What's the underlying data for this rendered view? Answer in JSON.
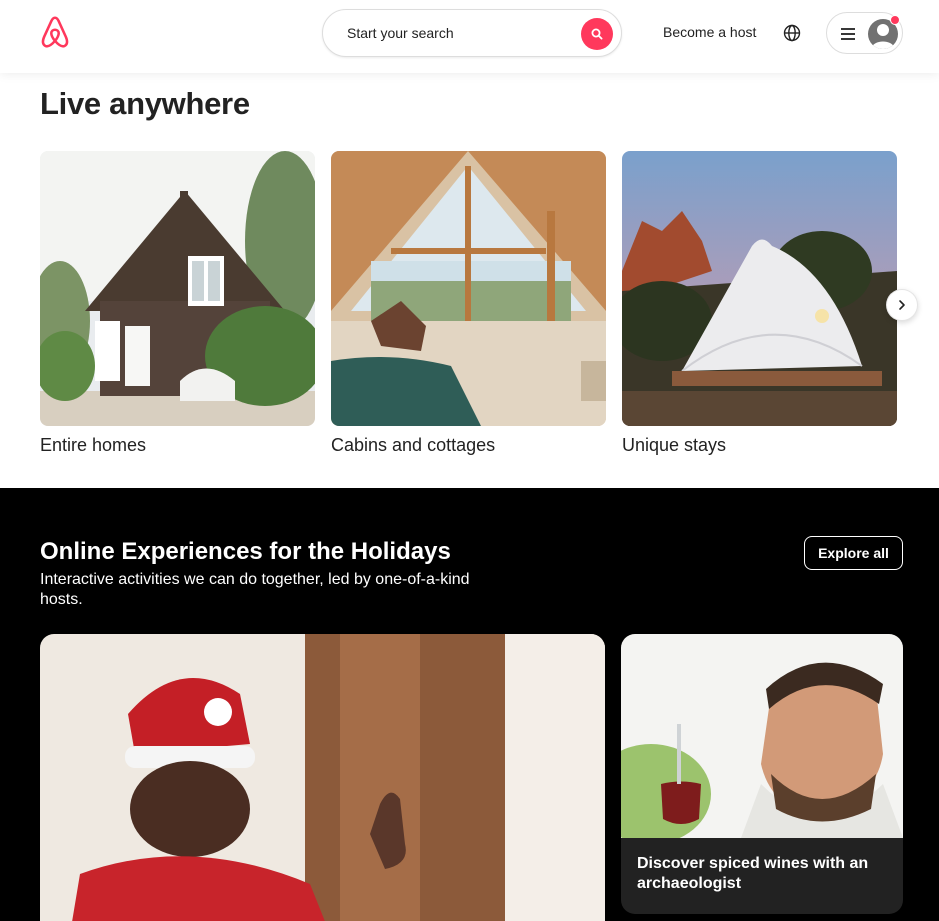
{
  "header": {
    "search_placeholder": "Start your search",
    "become_host": "Become a host",
    "brand_color": "#FF385C"
  },
  "live_anywhere": {
    "title": "Live anywhere",
    "cards": [
      {
        "label": "Entire homes"
      },
      {
        "label": "Cabins and cottages"
      },
      {
        "label": "Unique stays"
      }
    ]
  },
  "experiences": {
    "title": "Online Experiences for the Holidays",
    "subtitle": "Interactive activities we can do together, led by one-of-a-kind hosts.",
    "explore_label": "Explore all",
    "cards": [
      {
        "caption": "Discover spiced wines with an archaeologist"
      }
    ]
  }
}
